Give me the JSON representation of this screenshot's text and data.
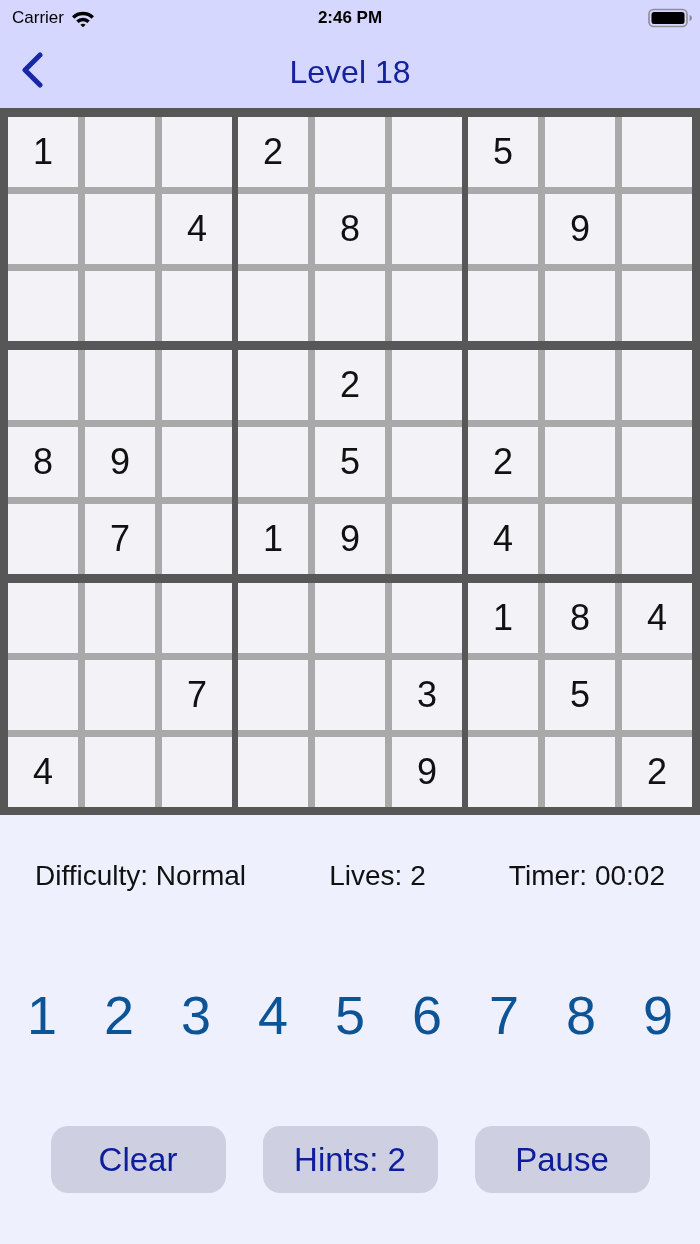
{
  "status_bar": {
    "carrier": "Carrier",
    "time": "2:46 PM"
  },
  "nav_bar": {
    "title": "Level 18"
  },
  "board": {
    "rows": [
      [
        "1",
        null,
        null,
        "2",
        null,
        null,
        "5",
        null,
        null
      ],
      [
        null,
        null,
        "4",
        null,
        "8",
        null,
        null,
        "9",
        null
      ],
      [
        null,
        null,
        null,
        null,
        null,
        null,
        null,
        null,
        null
      ],
      [
        null,
        null,
        null,
        null,
        "2",
        null,
        null,
        null,
        null
      ],
      [
        "8",
        "9",
        null,
        null,
        "5",
        null,
        "2",
        null,
        null
      ],
      [
        null,
        "7",
        null,
        "1",
        "9",
        null,
        "4",
        null,
        null
      ],
      [
        null,
        null,
        null,
        null,
        null,
        null,
        "1",
        "8",
        "4"
      ],
      [
        null,
        null,
        "7",
        null,
        null,
        "3",
        null,
        "5",
        null
      ],
      [
        "4",
        null,
        null,
        null,
        null,
        "9",
        null,
        null,
        "2"
      ]
    ]
  },
  "info": {
    "difficulty": "Difficulty: Normal",
    "lives": "Lives: 2",
    "timer": "Timer: 00:02"
  },
  "number_pad": [
    "1",
    "2",
    "3",
    "4",
    "5",
    "6",
    "7",
    "8",
    "9"
  ],
  "buttons": [
    "Clear",
    "Hints: 2",
    "Pause"
  ]
}
